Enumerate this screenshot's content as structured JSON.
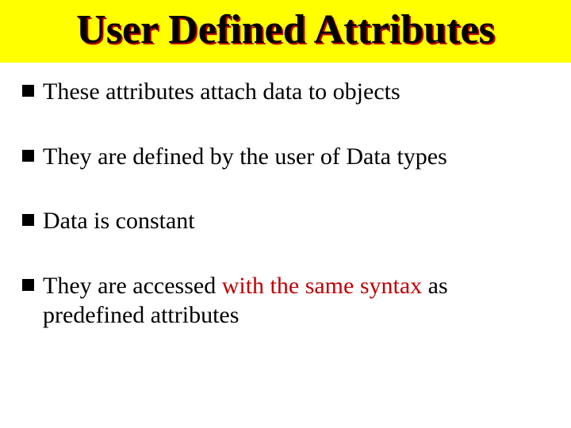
{
  "title": "User Defined Attributes",
  "bullets": {
    "b1": "These attributes attach data to objects",
    "b2": "They are defined by the user of Data types",
    "b3": "Data is constant",
    "b4_pre": "They are accessed ",
    "b4_hl": "with the same syntax",
    "b4_post": " as predefined attributes"
  }
}
